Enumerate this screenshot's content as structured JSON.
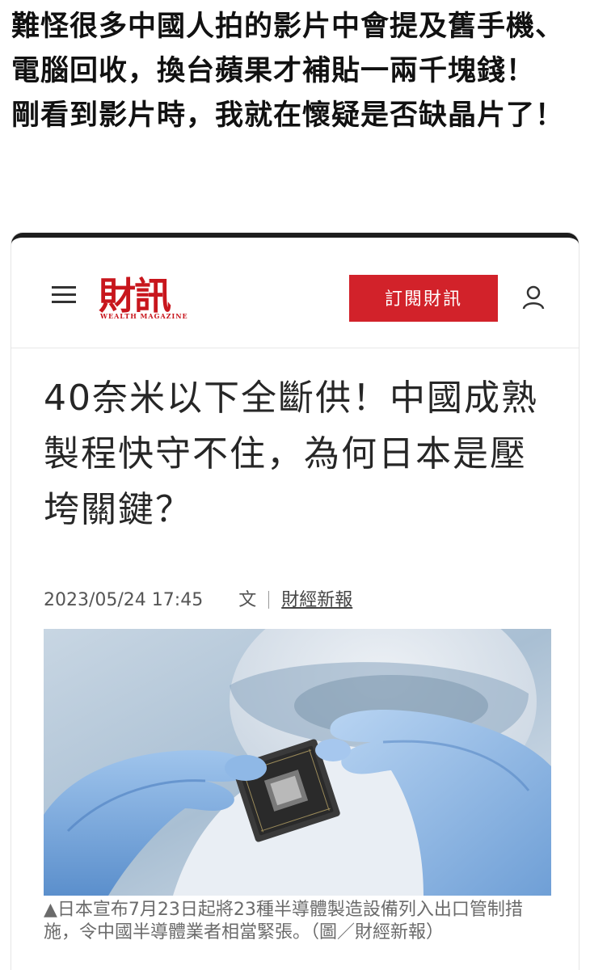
{
  "post": {
    "paragraph1": "難怪很多中國人拍的影片中會提及舊手機、電腦回收，換台蘋果才補貼一兩千塊錢！",
    "paragraph2": "剛看到影片時，我就在懷疑是否缺晶片了！"
  },
  "site": {
    "logo_text": "財訊",
    "logo_subtitle": "WEALTH MAGAZINE",
    "subscribe_label": "訂閱財訊",
    "icons": {
      "menu": "hamburger-menu-icon",
      "user": "user-account-icon"
    },
    "brand_color": "#d2222a"
  },
  "article": {
    "title": "40奈米以下全斷供！中國成熟製程快守不住，為何日本是壓垮關鍵？",
    "date": "2023/05/24 17:45",
    "author_prefix": "文",
    "source": "財經新報",
    "image_alt": "戴手套的手持半導體晶片",
    "caption": "▲日本宣布7月23日起將23種半導體製造設備列入出口管制措施，令中國半導體業者相當緊張。（圖／財經新報）"
  }
}
